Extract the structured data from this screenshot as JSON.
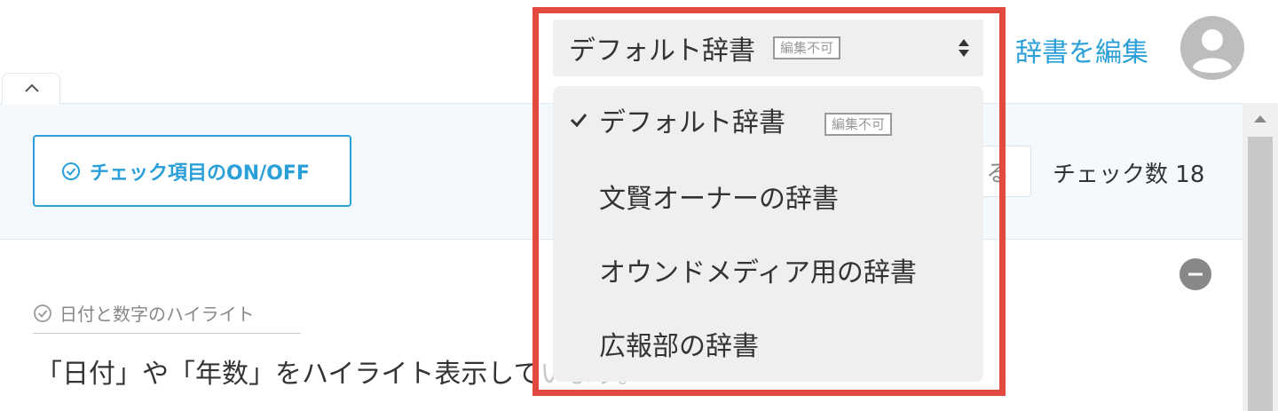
{
  "header": {
    "dictionary_select": {
      "selected": "デフォルト辞書",
      "badge": "編集不可"
    },
    "edit_dictionary_link": "辞書を編集"
  },
  "dropdown": {
    "items": [
      {
        "label": "デフォルト辞書",
        "badge": "編集不可",
        "checked": true
      },
      {
        "label": "文賢オーナーの辞書"
      },
      {
        "label": "オウンドメディア用の辞書"
      },
      {
        "label": "広報部の辞書"
      }
    ]
  },
  "toolbar": {
    "toggle_checks_label": "チェック項目のON/OFF",
    "search_partial": "る",
    "check_count_label": "チェック数",
    "check_count_value": "18"
  },
  "rule": {
    "title": "日付と数字のハイライト",
    "desc_visible": "「日付」や「年数」をハイライト表示して",
    "desc_faded": "います。"
  },
  "colors": {
    "accent": "#2a9fd8",
    "highlight": "#e24a3f"
  }
}
